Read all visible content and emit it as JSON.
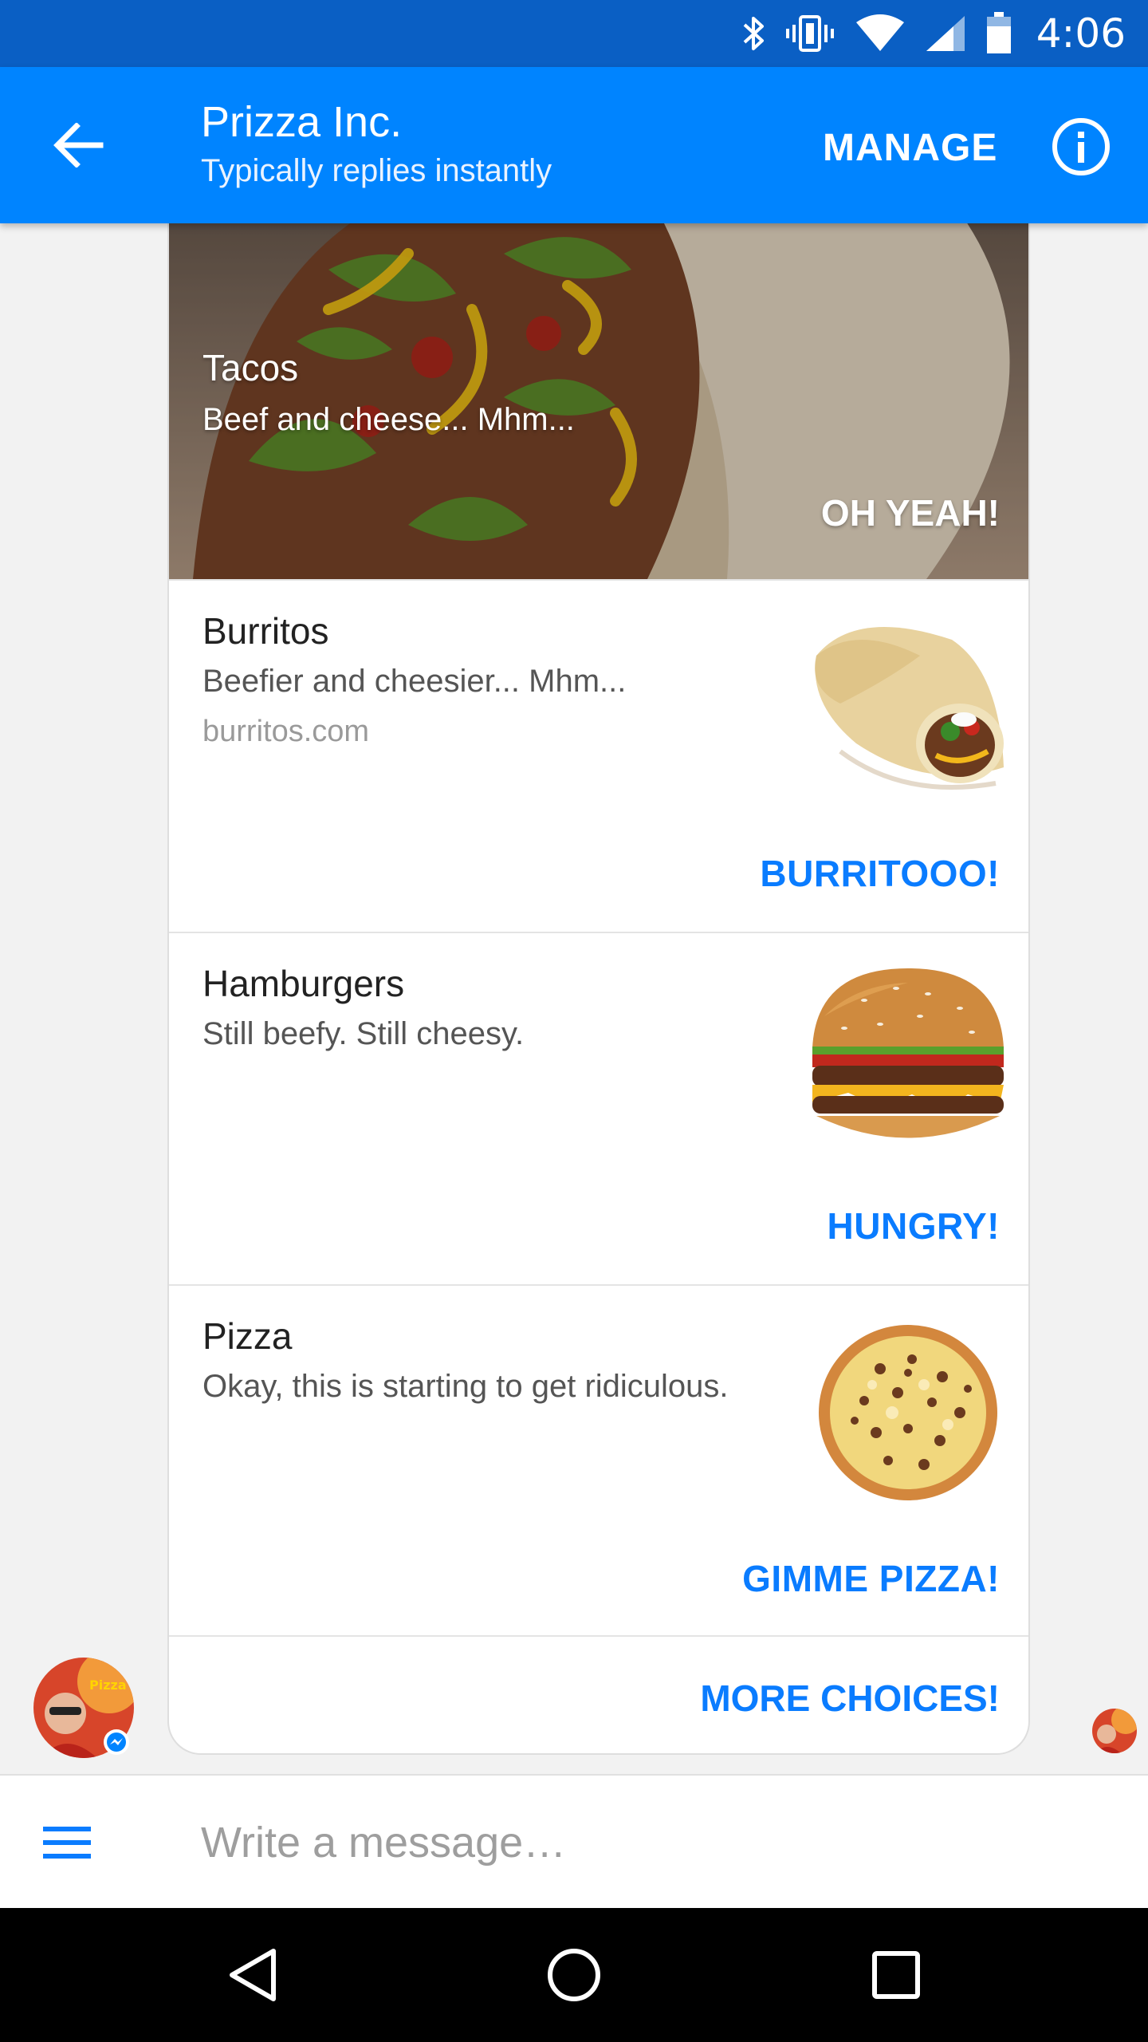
{
  "status_bar": {
    "time": "4:06",
    "icons": [
      "bluetooth-icon",
      "vibrate-icon",
      "wifi-icon",
      "signal-icon",
      "battery-icon"
    ]
  },
  "app_bar": {
    "title": "Prizza Inc.",
    "subtitle": "Typically replies instantly",
    "manage_label": "MANAGE",
    "back_icon": "arrow-back-icon",
    "info_icon": "info-icon"
  },
  "cards": {
    "hero": {
      "title": "Tacos",
      "subtitle": "Beef and cheese... Mhm...",
      "button": "OH YEAH!"
    },
    "items": [
      {
        "title": "Burritos",
        "subtitle": "Beefier and cheesier... Mhm...",
        "url": "burritos.com",
        "button": "BURRITOOO!",
        "image": "burrito-image"
      },
      {
        "title": "Hamburgers",
        "subtitle": "Still beefy. Still cheesy.",
        "url": "",
        "button": "HUNGRY!",
        "image": "hamburger-image"
      },
      {
        "title": "Pizza",
        "subtitle": "Okay, this is starting to get ridiculous.",
        "url": "",
        "button": "GIMME PIZZA!",
        "image": "pizza-image"
      }
    ],
    "more_button": "MORE CHOICES!"
  },
  "composer": {
    "placeholder": "Write a message…",
    "value": "",
    "menu_icon": "menu-icon"
  },
  "nav_bar": {
    "buttons": [
      "back-triangle-icon",
      "home-circle-icon",
      "recents-square-icon"
    ]
  },
  "colors": {
    "status_bar": "#0a5fc4",
    "app_bar": "#0084ff",
    "accent": "#0a7cff",
    "background": "#f2f2f2"
  }
}
